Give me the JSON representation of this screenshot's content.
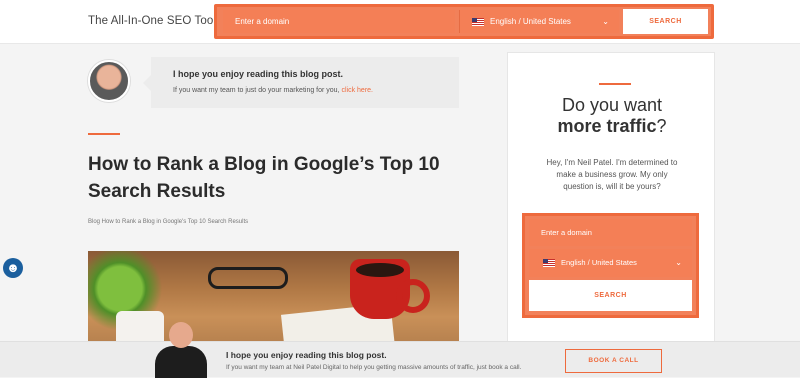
{
  "header": {
    "brand": "The All-In-One SEO Tool",
    "search": {
      "domain_placeholder": "Enter a domain",
      "language": "English / United States",
      "button": "SEARCH"
    }
  },
  "banner": {
    "title": "I hope you enjoy reading this blog post.",
    "subtitle": "If you want my team to just do your marketing for you,",
    "link": "click here."
  },
  "post": {
    "title": "How to Rank a Blog in Google’s Top 10 Search Results",
    "breadcrumb": "Blog How to Rank a Blog in Google's Top 10 Search Results"
  },
  "sidebar": {
    "heading_line1": "Do you want",
    "heading_bold": "more traffic",
    "heading_suffix": "?",
    "text": "Hey, I'm Neil Patel. I'm determined to make a business grow. My only question is, will it be yours?",
    "form": {
      "domain_placeholder": "Enter a domain",
      "language": "English / United States",
      "button": "SEARCH"
    }
  },
  "bottom_bar": {
    "title": "I hope you enjoy reading this blog post.",
    "subtitle": "If you want my team at Neil Patel Digital to help you getting massive amounts of traffic, just book a call.",
    "button": "BOOK A CALL"
  },
  "icons": {
    "accessibility": "accessibility-icon",
    "chevron": "chevron-down-icon",
    "flag": "us-flag-icon"
  },
  "colors": {
    "accent": "#ee6a3d",
    "accent_light": "#f2815a"
  }
}
